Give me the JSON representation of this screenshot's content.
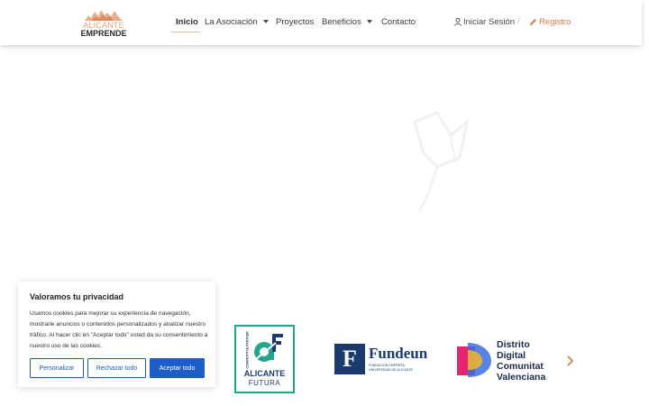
{
  "logo": {
    "line1": "ALICANTE",
    "line2": "EMPRENDE"
  },
  "nav": {
    "items": [
      {
        "label": "Inicio",
        "active": true,
        "dropdown": false
      },
      {
        "label": "La Asociación",
        "active": false,
        "dropdown": true
      },
      {
        "label": "Proyectos",
        "active": false,
        "dropdown": false
      },
      {
        "label": "Beneficios",
        "active": false,
        "dropdown": true
      },
      {
        "label": "Contacto",
        "active": false,
        "dropdown": false
      }
    ],
    "login_label": "Iniciar Sesión",
    "separator": "/",
    "register_label": "Registro"
  },
  "cookie_banner": {
    "title": "Valoramos tu privacidad",
    "text": "Usamos cookies para mejorar su experiencia de navegación, mostrarle anuncios o contenidos personalizados y analizar nuestro tráfico. Al hacer clic en \"Aceptar todo\" usted da su consentimiento a nuestro uso de las cookies.",
    "buttons": {
      "customize": "Personalizar",
      "reject": "Rechazar todo",
      "accept": "Aceptar todo"
    }
  },
  "partners": {
    "alicante_futura": {
      "badge": "COMPETITIVE PARTNER",
      "line1": "ALICANTE",
      "line2": "FUTURA"
    },
    "fundeun": {
      "mark": "F",
      "name": "Fundeun",
      "subtitle_line1": "FUNDACIÓN EMPRESA",
      "subtitle_line2": "UNIVERSIDAD DE ALICANTE"
    },
    "distrito": {
      "line1": "Distrito",
      "line2": "Digital",
      "line3": "Comunitat",
      "line4": "Valenciana"
    }
  },
  "colors": {
    "accent_orange": "#e0764a",
    "logo_orange": "#e0a17a",
    "cookie_blue": "#1e5cc9",
    "partner_navy": "#1b3b6f",
    "af_green": "#22a58b"
  },
  "icons": {
    "login": "user-icon",
    "register": "pencil-icon",
    "carousel_next": "chevron-right-icon"
  }
}
